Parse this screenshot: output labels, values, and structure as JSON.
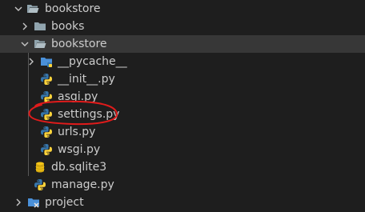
{
  "explorer": {
    "items": [
      {
        "label": "bookstore",
        "kind": "folder",
        "expanded": true,
        "icon": "folder-open-icon"
      },
      {
        "label": "books",
        "kind": "folder",
        "expanded": false,
        "icon": "folder-icon"
      },
      {
        "label": "bookstore",
        "kind": "folder",
        "expanded": true,
        "icon": "folder-open-icon"
      },
      {
        "label": "__pycache__",
        "kind": "folder",
        "expanded": false,
        "icon": "folder-pycache-icon"
      },
      {
        "label": "__init__.py",
        "kind": "file",
        "icon": "python-icon"
      },
      {
        "label": "asgi.py",
        "kind": "file",
        "icon": "python-icon"
      },
      {
        "label": "settings.py",
        "kind": "file",
        "icon": "python-icon",
        "annotation": "red-circle"
      },
      {
        "label": "urls.py",
        "kind": "file",
        "icon": "python-icon"
      },
      {
        "label": "wsgi.py",
        "kind": "file",
        "icon": "python-icon"
      },
      {
        "label": "db.sqlite3",
        "kind": "file",
        "icon": "database-icon"
      },
      {
        "label": "manage.py",
        "kind": "file",
        "icon": "python-icon"
      },
      {
        "label": "project",
        "kind": "folder",
        "expanded": false,
        "icon": "folder-tools-icon"
      }
    ]
  },
  "colors": {
    "background": "#1e1e1e",
    "selected_row": "#373737",
    "text": "#cccccc",
    "folder": "#90a4ae",
    "python_blue": "#3776ab",
    "python_yellow": "#ffd43b",
    "database": "#f5c518",
    "pycache_folder": "#4a90d9",
    "annotation": "#e01b1b"
  }
}
